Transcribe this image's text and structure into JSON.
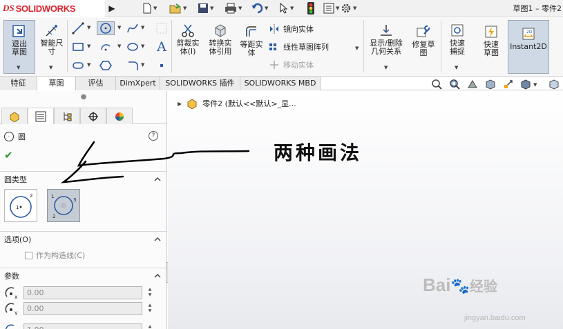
{
  "app": {
    "logo_prefix": "DS",
    "logo_text": "SOLIDWORKS",
    "document_title": "草图1 – 零件2"
  },
  "ribbon": {
    "exit_sketch": "退出草图",
    "smart_dimension": "智能尺寸",
    "trim_entities": "剪裁实体(I)",
    "convert_entities": "转换实体引用",
    "offset_entities": "等距实体",
    "mirror_entities": "镜向实体",
    "linear_pattern": "线性草图阵列",
    "move_entities": "移动实体",
    "display_delete_relations": "显示/删除几何关系",
    "repair_sketch": "修复草图",
    "quick_snaps": "快速捕捉",
    "rapid_sketch": "快速草图",
    "instant2d": "Instant2D"
  },
  "tabs": [
    {
      "label": "特征"
    },
    {
      "label": "草图"
    },
    {
      "label": "评估"
    },
    {
      "label": "DimXpert"
    },
    {
      "label": "SOLIDWORKS 插件"
    },
    {
      "label": "SOLIDWORKS MBD"
    }
  ],
  "tree": {
    "part_label": "零件2  (默认<<默认>_显..."
  },
  "property_manager": {
    "title": "圆",
    "circle_type_section": "圆类型",
    "options_section": "选项(O)",
    "construction_label": "作为构造线(C)",
    "parameters_section": "参数",
    "param_x": "0.00",
    "param_y": "0.00",
    "param_r": "1.00",
    "type_center_labels": [
      "1",
      "2"
    ],
    "type_perimeter_labels": [
      "1",
      "2",
      "3"
    ]
  },
  "annotation": {
    "text": "两种画法"
  },
  "watermark": {
    "brand": "Bai",
    "brand2": "经验",
    "url": "jingyan.baidu.com"
  },
  "colors": {
    "logo_red": "#d9232d",
    "ribbon_bg": "#f7f7f7",
    "active_blue": "#cfd9e6",
    "ok_green": "#2f9a2f"
  }
}
